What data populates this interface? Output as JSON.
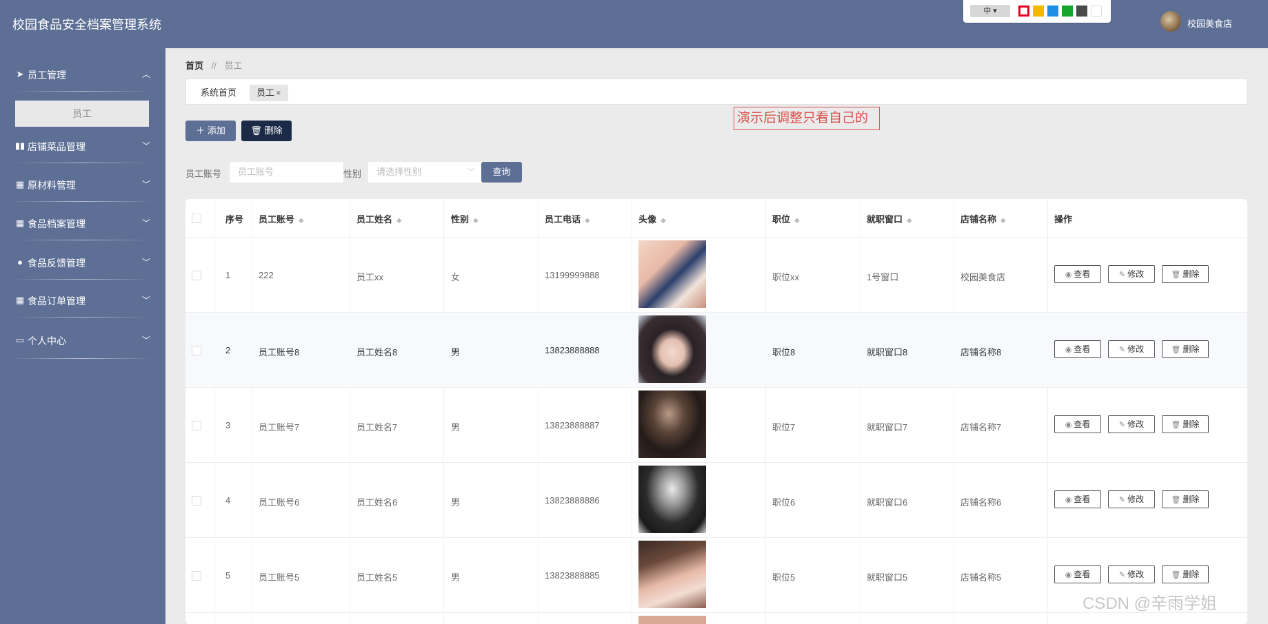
{
  "header": {
    "title": "校园食品安全档案管理系统",
    "lang_label": "中 ▾",
    "theme_colors": [
      "#e4001f",
      "#f2b800",
      "#1e8fe8",
      "#17a42d",
      "#4a4a4a",
      "#ffffff"
    ],
    "user_name": "校园美食店"
  },
  "sidebar": {
    "items": [
      {
        "label": "员工管理",
        "icon": "send-icon",
        "expanded": true
      },
      {
        "label": "店铺菜品管理",
        "icon": "books-icon",
        "expanded": false
      },
      {
        "label": "原材料管理",
        "icon": "grid-icon",
        "expanded": false
      },
      {
        "label": "食品档案管理",
        "icon": "table-icon",
        "expanded": false
      },
      {
        "label": "食品反馈管理",
        "icon": "location-icon",
        "expanded": false
      },
      {
        "label": "食品订单管理",
        "icon": "grid-icon",
        "expanded": false
      },
      {
        "label": "个人中心",
        "icon": "window-icon",
        "expanded": false
      }
    ],
    "submenu_active": "员工"
  },
  "breadcrumb": {
    "home": "首页",
    "separator": "//",
    "current": "员工"
  },
  "tabs": [
    {
      "label": "系统首页",
      "active": false
    },
    {
      "label": "员工",
      "active": true,
      "close": "×"
    }
  ],
  "annotation": "演示后调整只看自己的",
  "toolbar": {
    "add_label": "添加",
    "delete_label": "删除"
  },
  "filters": {
    "account_label": "员工账号",
    "account_placeholder": "员工账号",
    "gender_label": "性别",
    "gender_placeholder": "请选择性别",
    "query_label": "查询"
  },
  "table": {
    "columns": [
      "序号",
      "员工账号",
      "员工姓名",
      "性别",
      "员工电话",
      "头像",
      "职位",
      "就职窗口",
      "店铺名称",
      "操作"
    ],
    "actions": {
      "view": "查看",
      "edit": "修改",
      "delete": "删除"
    },
    "rows": [
      {
        "no": "1",
        "account": "222",
        "name": "员工xx",
        "gender": "女",
        "phone": "13199999888",
        "position": "职位xx",
        "window": "1号窗口",
        "shop": "校园美食店"
      },
      {
        "no": "2",
        "account": "员工账号8",
        "name": "员工姓名8",
        "gender": "男",
        "phone": "13823888888",
        "position": "职位8",
        "window": "就职窗口8",
        "shop": "店铺名称8"
      },
      {
        "no": "3",
        "account": "员工账号7",
        "name": "员工姓名7",
        "gender": "男",
        "phone": "13823888887",
        "position": "职位7",
        "window": "就职窗口7",
        "shop": "店铺名称7"
      },
      {
        "no": "4",
        "account": "员工账号6",
        "name": "员工姓名6",
        "gender": "男",
        "phone": "13823888886",
        "position": "职位6",
        "window": "就职窗口6",
        "shop": "店铺名称6"
      },
      {
        "no": "5",
        "account": "员工账号5",
        "name": "员工姓名5",
        "gender": "男",
        "phone": "13823888885",
        "position": "职位5",
        "window": "就职窗口5",
        "shop": "店铺名称5"
      }
    ]
  },
  "watermark": "CSDN @辛雨学姐"
}
